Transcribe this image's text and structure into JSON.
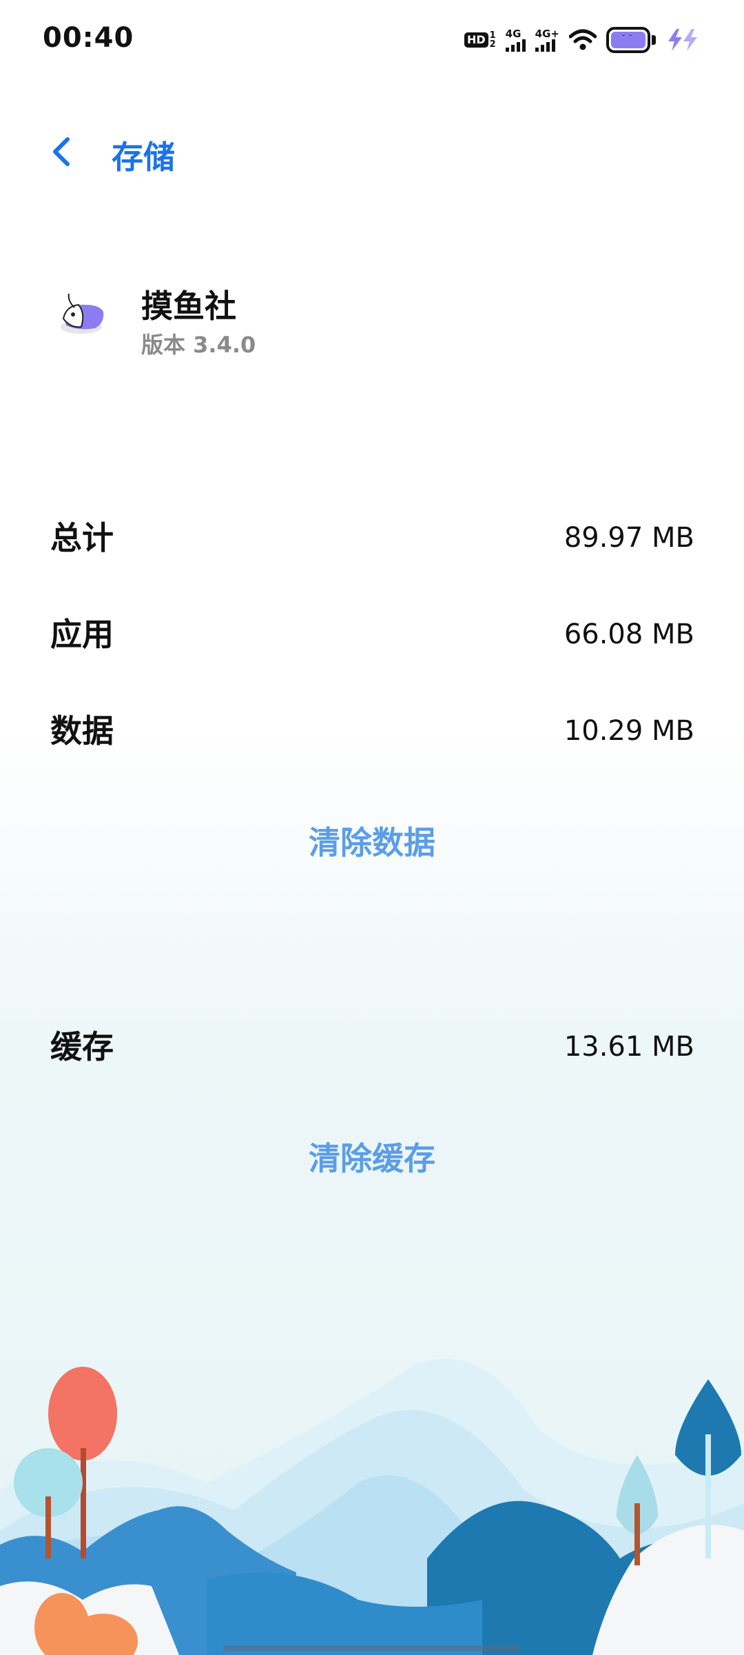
{
  "status_bar": {
    "time": "00:40",
    "hd_label": "HD",
    "hd_sub_top": "1",
    "hd_sub_bottom": "2",
    "sim1_label": "4G",
    "sim2_label": "4G+",
    "battery_color": "#8b7cf2",
    "icons": [
      "hd-icon",
      "signal-icon",
      "signal-icon",
      "wifi-icon",
      "battery-icon",
      "charging-icon"
    ]
  },
  "header": {
    "back_icon": "chevron-left-icon",
    "title": "存储",
    "accent_color": "#1a73e8"
  },
  "app": {
    "name": "摸鱼社",
    "version": "版本 3.4.0",
    "icon": "app-fish-icon"
  },
  "storage": {
    "total": {
      "label": "总计",
      "value": "89.97 MB"
    },
    "app": {
      "label": "应用",
      "value": "66.08 MB"
    },
    "data": {
      "label": "数据",
      "value": "10.29 MB"
    },
    "clear_data": "清除数据",
    "cache": {
      "label": "缓存",
      "value": "13.61 MB"
    },
    "clear_cache": "清除缓存"
  }
}
